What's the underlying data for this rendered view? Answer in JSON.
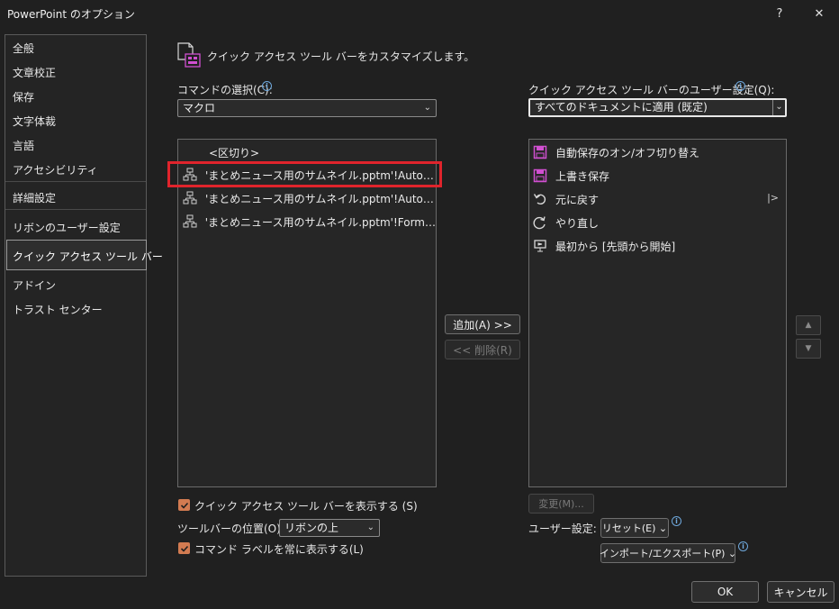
{
  "window": {
    "title": "PowerPoint のオプション",
    "help_glyph": "?",
    "close_glyph": "✕"
  },
  "sidebar": {
    "items": [
      {
        "label": "全般"
      },
      {
        "label": "文章校正"
      },
      {
        "label": "保存"
      },
      {
        "label": "文字体裁"
      },
      {
        "label": "言語"
      },
      {
        "label": "アクセシビリティ"
      },
      {
        "label": "詳細設定"
      },
      {
        "label": "リボンのユーザー設定"
      },
      {
        "label": "クイック アクセス ツール バー"
      },
      {
        "label": "アドイン"
      },
      {
        "label": "トラスト センター"
      }
    ],
    "active_index": 8
  },
  "main": {
    "heading": "クイック アクセス ツール バーをカスタマイズします。",
    "choose_commands": {
      "label": "コマンドの選択(C):",
      "value": "マクロ"
    },
    "left_list": [
      {
        "label": "<区切り>",
        "icon": "none"
      },
      {
        "label": "'まとめニュース用のサムネイル.pptm'!Auto…",
        "icon": "macro-icon"
      },
      {
        "label": "'まとめニュース用のサムネイル.pptm'!Auto…",
        "icon": "macro-icon"
      },
      {
        "label": "'まとめニュース用のサムネイル.pptm'!Form…",
        "icon": "macro-icon"
      }
    ],
    "customize_qat": {
      "label": "クイック アクセス ツール バーのユーザー設定(Q):",
      "value": "すべてのドキュメントに適用 (既定)"
    },
    "right_list": [
      {
        "label": "自動保存のオン/オフ切り替え",
        "icon": "save-icon"
      },
      {
        "label": "上書き保存",
        "icon": "save-icon"
      },
      {
        "label": "元に戻す",
        "icon": "undo-icon"
      },
      {
        "label": "やり直し",
        "icon": "redo-icon"
      },
      {
        "label": "最初から [先頭から開始]",
        "icon": "slideshow-icon"
      }
    ],
    "add_button": "追加(A) >>",
    "remove_button": "<< 削除(R)",
    "modify_button": "変更(M)...",
    "show_qat_checkbox": "クイック アクセス ツール バーを表示する (S)",
    "toolbar_position_label": "ツールバーの位置(O)",
    "toolbar_position_value": "リボンの上",
    "show_labels_checkbox": "コマンド ラベルを常に表示する(L)",
    "customizations_label": "ユーザー設定:",
    "reset_button": "リセット(E) ⌄",
    "import_export_button": "インポート/エクスポート(P) ⌄",
    "info_glyph": "i",
    "expand_glyph": "|>"
  },
  "footer": {
    "ok_button": "OK",
    "cancel_button": "キャンセル"
  },
  "colors": {
    "background": "#202020",
    "checkbox_accent": "#d27b51",
    "highlight": "#e0242c",
    "info": "#6fa8dc",
    "save_icon": "#d04fd0"
  }
}
